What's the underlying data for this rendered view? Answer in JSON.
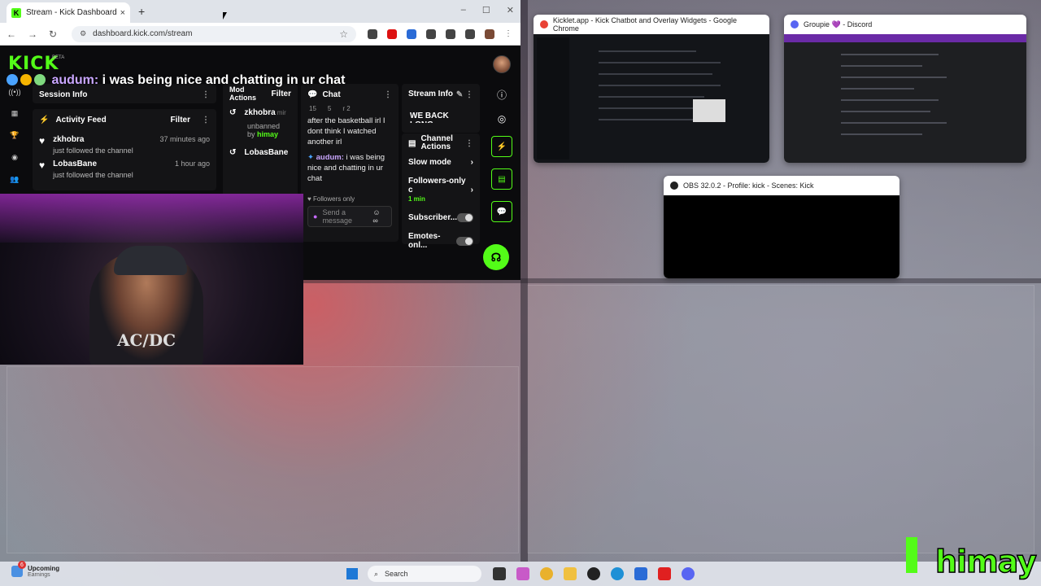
{
  "chrome": {
    "tab_title": "Stream - Kick Dashboard",
    "tab_close": "×",
    "new_tab": "+",
    "url": "dashboard.kick.com/stream",
    "win_controls": [
      "–",
      "☐",
      "✕"
    ]
  },
  "kick": {
    "logo": "KICK",
    "beta": "BETA",
    "overlay_chat": {
      "user": "audum:",
      "message": " i was being nice and chatting in ur chat"
    }
  },
  "session_info": {
    "title": "Session Info"
  },
  "activity_feed": {
    "title": "Activity Feed",
    "filter": "Filter",
    "items": [
      {
        "name": "zkhobra",
        "sub": "just followed the channel",
        "time": "37 minutes ago"
      },
      {
        "name": "LobasBane",
        "sub": "just followed the channel",
        "time": "1 hour ago"
      }
    ]
  },
  "mod_actions": {
    "title": "Mod Actions",
    "filter": "Filter",
    "items": [
      {
        "name": "zkhobra",
        "suffix": "mir",
        "action": "unbanned",
        "by_label": "by",
        "by": "himay"
      },
      {
        "name": "LobasBane",
        "suffix": "",
        "action": "",
        "by_label": "",
        "by": ""
      }
    ]
  },
  "chat": {
    "title": "Chat",
    "counts": [
      "15",
      "5",
      "r 2"
    ],
    "msg1": "after the basketball irl I dont think I watched another irl",
    "msg2_user": "audum:",
    "msg2_text": " i was being nice and chatting in ur chat",
    "followers_only": "Followers only",
    "placeholder": "Send a message"
  },
  "stream_info": {
    "title": "Stream Info",
    "text": "WE BACK LONG STREAM!!"
  },
  "channel_actions": {
    "title": "Channel Actions",
    "rows": [
      {
        "label": "Slow mode",
        "kind": "chevron"
      },
      {
        "label": "Followers-only c",
        "sub": "1 min",
        "kind": "chevron"
      },
      {
        "label": "Subscriber...",
        "kind": "toggle"
      },
      {
        "label": "Emotes-onl...",
        "kind": "toggle"
      }
    ]
  },
  "windows": {
    "kicklet": "Kicklet.app - Kick Chatbot and Overlay Widgets - Google Chrome",
    "discord": "Groupie 💜 - Discord",
    "obs": "OBS 32.0.2 - Profile: kick - Scenes: Kick"
  },
  "webcam": {
    "shirt": "AC/DC"
  },
  "taskbar": {
    "weather_badge": "6",
    "weather_title": "Upcoming",
    "weather_sub": "Earnings",
    "search": "Search"
  },
  "watermark": "himay"
}
